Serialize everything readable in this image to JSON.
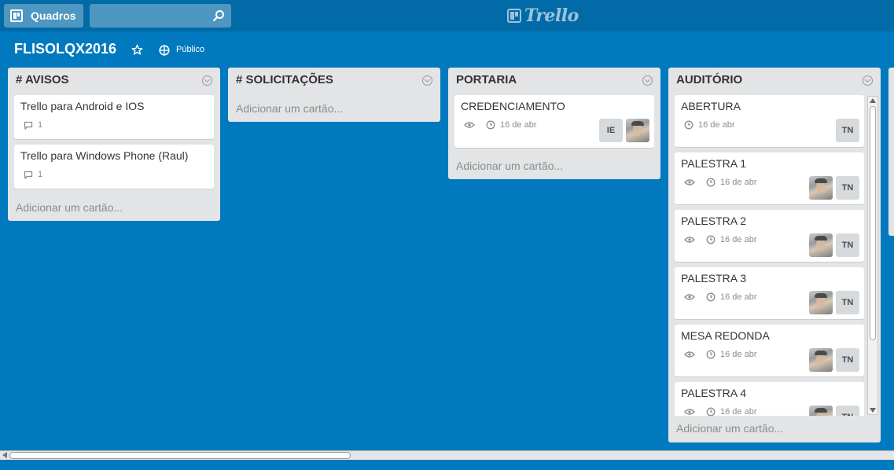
{
  "header": {
    "boards_label": "Quadros",
    "search_placeholder": "",
    "logo_text": "Trello"
  },
  "board": {
    "title": "FLISOLQX2016",
    "visibility": "Público"
  },
  "colors": {
    "background": "#0079bf",
    "header": "#026aa7",
    "list": "#e2e4e6"
  },
  "lists": [
    {
      "title": "# AVISOS",
      "add_label": "Adicionar um cartão...",
      "cards": [
        {
          "title": "Trello para Android e IOS",
          "comments": "1"
        },
        {
          "title": "Trello para Windows Phone (Raul)",
          "comments": "1"
        }
      ]
    },
    {
      "title": "# SOLICITAÇÕES",
      "add_label": "Adicionar um cartão...",
      "cards": []
    },
    {
      "title": "PORTARIA",
      "add_label": "Adicionar um cartão...",
      "cards": [
        {
          "title": "CREDENCIAMENTO",
          "due": "16 de abr",
          "members": [
            "IE"
          ]
        }
      ]
    },
    {
      "title": "AUDITÓRIO",
      "add_label": "Adicionar um cartão...",
      "cards": [
        {
          "title": "ABERTURA",
          "due": "16 de abr",
          "members": [
            "TN"
          ]
        },
        {
          "title": "PALESTRA 1",
          "due": "16 de abr",
          "members": [
            "TN"
          ]
        },
        {
          "title": "PALESTRA 2",
          "due": "16 de abr",
          "members": [
            "TN"
          ]
        },
        {
          "title": "PALESTRA 3",
          "due": "16 de abr",
          "members": [
            "TN"
          ]
        },
        {
          "title": "MESA REDONDA",
          "due": "16 de abr",
          "members": [
            "TN"
          ]
        },
        {
          "title": "PALESTRA 4",
          "due": "16 de abr",
          "members": [
            "TN"
          ]
        }
      ]
    }
  ]
}
